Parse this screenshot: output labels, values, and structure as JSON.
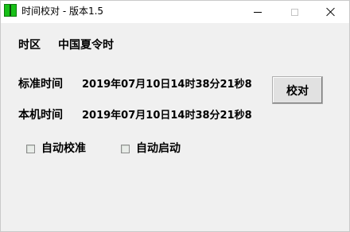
{
  "window": {
    "title": "时间校对 - 版本1.5"
  },
  "timezone": {
    "label": "时区",
    "value": "中国夏令时"
  },
  "standard_time": {
    "label": "标准时间",
    "value": "2019年07月10日14时38分21秒8"
  },
  "local_time": {
    "label": "本机时间",
    "value": "2019年07月10日14时38分21秒8"
  },
  "calibrate_button": {
    "label": "校对"
  },
  "options": {
    "auto_calibrate": {
      "label": "自动校准",
      "checked": false
    },
    "auto_start": {
      "label": "自动启动",
      "checked": false
    }
  },
  "colors": {
    "window_bg": "#f0f0f0",
    "titlebar_bg": "#ffffff",
    "icon_green": "#18c018"
  },
  "icons": {
    "app": "app-clock-icon",
    "minimize": "minimize-icon",
    "maximize": "maximize-icon",
    "close": "close-icon"
  }
}
